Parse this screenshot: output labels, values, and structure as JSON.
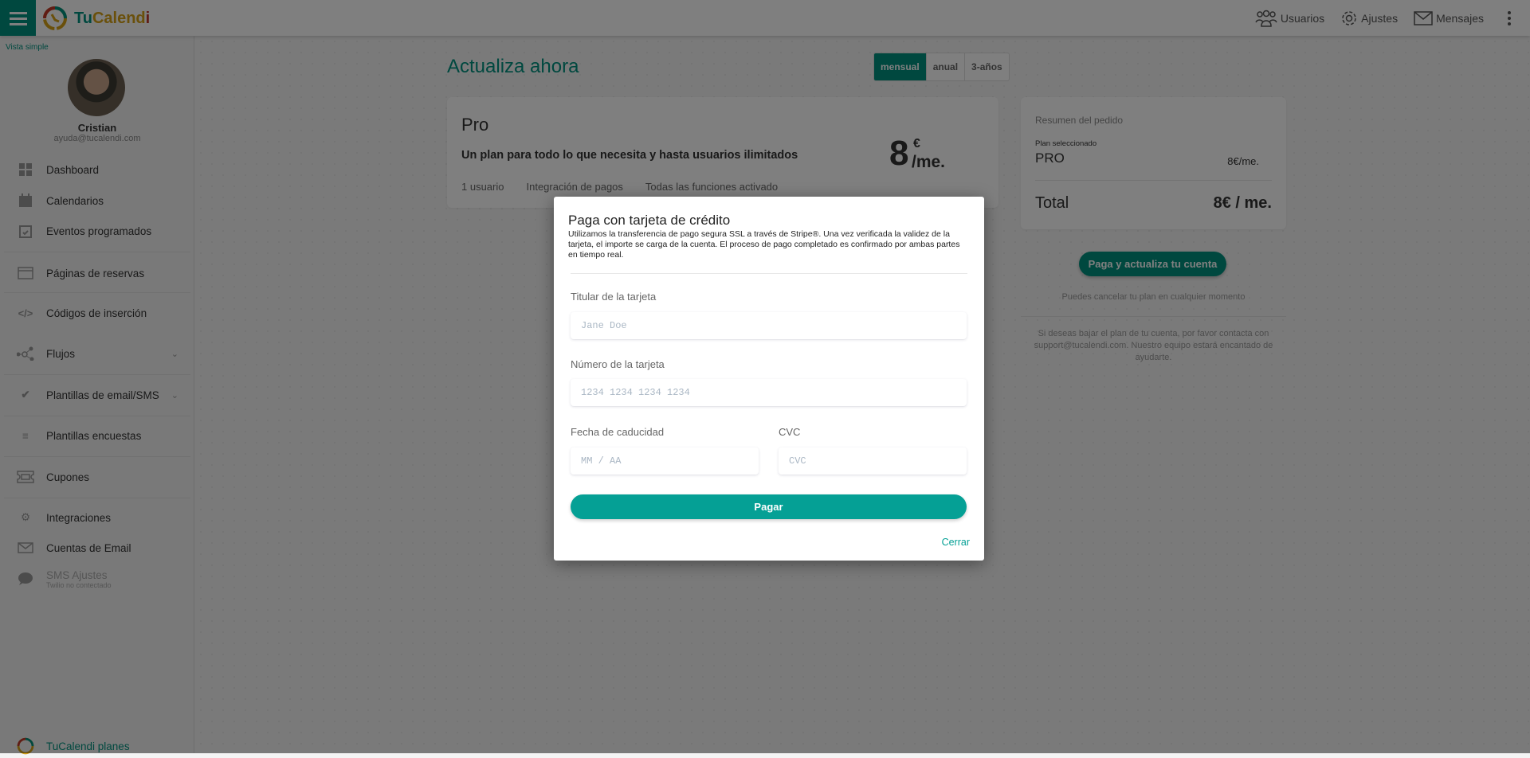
{
  "topbar": {
    "brand_tu": "Tu",
    "brand_calend": "Calend",
    "brand_i": "i",
    "nav": [
      {
        "label": "Usuarios",
        "icon": "users-icon"
      },
      {
        "label": "Ajustes",
        "icon": "gear-icon"
      },
      {
        "label": "Mensajes",
        "icon": "mail-icon"
      }
    ]
  },
  "sidebar": {
    "view_toggle": "Vista simple",
    "user": {
      "name": "Cristian",
      "email": "ayuda@tucalendi.com"
    },
    "items": [
      {
        "label": "Dashboard"
      },
      {
        "label": "Calendarios"
      },
      {
        "label": "Eventos programados"
      },
      {
        "label": "Páginas de reservas"
      },
      {
        "label": "Códigos de inserción"
      },
      {
        "label": "Flujos"
      },
      {
        "label": "Plantillas de email/SMS"
      },
      {
        "label": "Plantillas encuestas"
      },
      {
        "label": "Cupones"
      },
      {
        "label": "Integraciones"
      },
      {
        "label": "Cuentas de Email"
      },
      {
        "label": "SMS Ajustes",
        "sublabel": "Twilio no contectado"
      }
    ],
    "plans_link": "TuCalendi planes"
  },
  "main": {
    "title": "Actualiza ahora",
    "billing": {
      "options": [
        "mensual",
        "anual",
        "3-años"
      ],
      "selected": "mensual"
    },
    "plan": {
      "name": "Pro",
      "description": "Un plan para todo lo que necesita y hasta usuarios ilimitados",
      "price": "8",
      "currency": "€",
      "period": "/me.",
      "features": [
        "1 usuario",
        "Integración de pagos",
        "Todas las funciones activado"
      ]
    },
    "summary": {
      "heading": "Resumen del pedido",
      "plan_label": "Plan seleccionado",
      "plan_name": "PRO",
      "plan_price": "8€/me.",
      "total_label": "Total",
      "total_value": "8€ / me."
    },
    "pay_button": "Paga y actualiza tu cuenta",
    "cancel_note": "Puedes cancelar tu plan en cualquier momento",
    "downgrade_note": "Si deseas bajar el plan de tu cuenta, por favor contacta con support@tucalendi.com. Nuestro equipo estará encantado de ayudarte."
  },
  "modal": {
    "title": "Paga con tarjeta de crédito",
    "description": "Utilizamos la transferencia de pago segura SSL a través de Stripe®. Una vez verificada la validez de la tarjeta, el importe se carga de la cuenta. El proceso de pago completado es confirmado por ambas partes en tiempo real.",
    "holder_label": "Titular de la tarjeta",
    "holder_placeholder": "Jane Doe",
    "number_label": "Número de la tarjeta",
    "number_placeholder": "1234 1234 1234 1234",
    "expiry_label": "Fecha de caducidad",
    "expiry_placeholder": "MM / AA",
    "cvc_label": "CVC",
    "cvc_placeholder": "CVC",
    "pay_label": "Pagar",
    "close_label": "Cerrar"
  },
  "colors": {
    "accent": "#00917f",
    "pay_button": "#05a095"
  }
}
